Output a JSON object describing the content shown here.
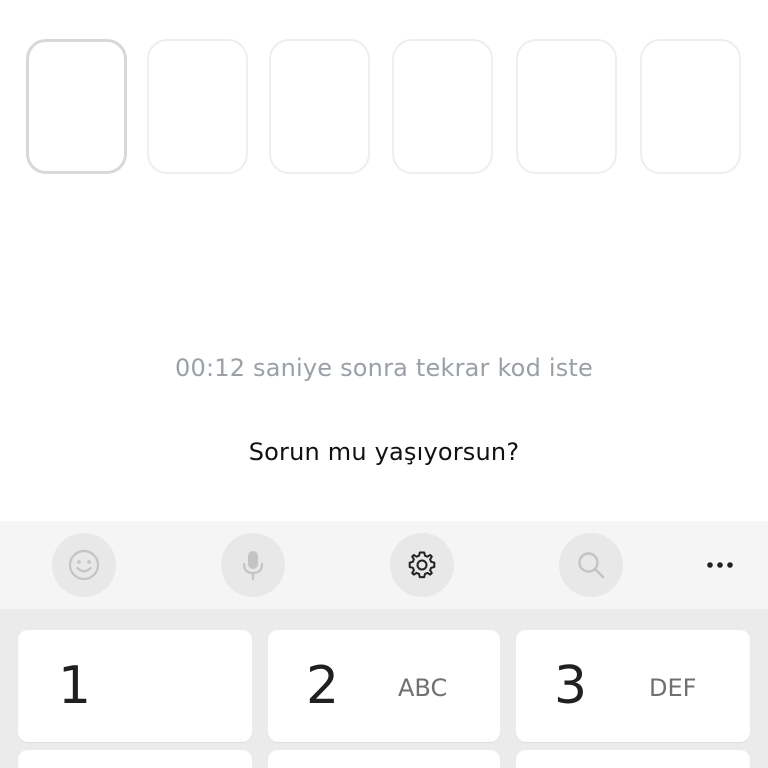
{
  "otp": {
    "box_count": 6,
    "values": [
      "",
      "",
      "",
      "",
      "",
      ""
    ],
    "active_index": 0
  },
  "timer_text": "00:12 saniye sonra tekrar kod iste",
  "help_link_text": "Sorun mu yaşıyorsun?",
  "keyboard": {
    "toolbar": {
      "icons": [
        "emoji-icon",
        "microphone-icon",
        "settings-gear-icon",
        "search-icon",
        "more-dots-icon"
      ]
    },
    "keys": [
      {
        "digit": "1",
        "letters": ""
      },
      {
        "digit": "2",
        "letters": "ABC"
      },
      {
        "digit": "3",
        "letters": "DEF"
      }
    ]
  },
  "colors": {
    "timer": "#9aa0a6",
    "link": "#111111",
    "keyboard_bg": "#ebebeb",
    "toolbar_bg": "#f5f5f5",
    "key_bg": "#ffffff"
  }
}
